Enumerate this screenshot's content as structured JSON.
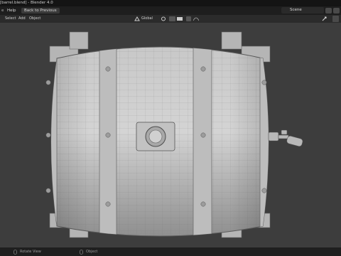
{
  "window": {
    "title": "[barrel.blend] - Blender 4.0"
  },
  "menu": {
    "help": "Help",
    "back_to_previous": "Back to Previous",
    "scene": "Scene"
  },
  "header": {
    "select": "Select",
    "add": "Add",
    "object": "Object",
    "orientation": "Global"
  },
  "status": {
    "rotate_view": "Rotate View",
    "object": "Object"
  },
  "icons": [
    "blender-logo-icon",
    "scene-icon",
    "transform-orientation-icon",
    "pivot-icon",
    "snap-icon",
    "proportional-icon",
    "gizmo-icon",
    "overlay-icon",
    "mouse-icon"
  ]
}
